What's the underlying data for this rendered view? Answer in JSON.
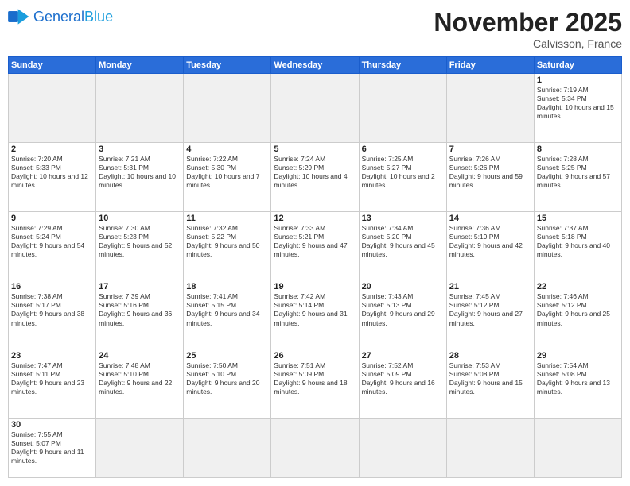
{
  "header": {
    "logo_general": "General",
    "logo_blue": "Blue",
    "month_title": "November 2025",
    "location": "Calvisson, France"
  },
  "days_of_week": [
    "Sunday",
    "Monday",
    "Tuesday",
    "Wednesday",
    "Thursday",
    "Friday",
    "Saturday"
  ],
  "weeks": [
    {
      "days": [
        {
          "num": "",
          "empty": true
        },
        {
          "num": "",
          "empty": true
        },
        {
          "num": "",
          "empty": true
        },
        {
          "num": "",
          "empty": true
        },
        {
          "num": "",
          "empty": true
        },
        {
          "num": "",
          "empty": true
        },
        {
          "num": "1",
          "sunrise": "7:19 AM",
          "sunset": "5:34 PM",
          "daylight": "10 hours and 15 minutes."
        }
      ]
    },
    {
      "days": [
        {
          "num": "2",
          "sunrise": "7:20 AM",
          "sunset": "5:33 PM",
          "daylight": "10 hours and 12 minutes."
        },
        {
          "num": "3",
          "sunrise": "7:21 AM",
          "sunset": "5:31 PM",
          "daylight": "10 hours and 10 minutes."
        },
        {
          "num": "4",
          "sunrise": "7:22 AM",
          "sunset": "5:30 PM",
          "daylight": "10 hours and 7 minutes."
        },
        {
          "num": "5",
          "sunrise": "7:24 AM",
          "sunset": "5:29 PM",
          "daylight": "10 hours and 4 minutes."
        },
        {
          "num": "6",
          "sunrise": "7:25 AM",
          "sunset": "5:27 PM",
          "daylight": "10 hours and 2 minutes."
        },
        {
          "num": "7",
          "sunrise": "7:26 AM",
          "sunset": "5:26 PM",
          "daylight": "9 hours and 59 minutes."
        },
        {
          "num": "8",
          "sunrise": "7:28 AM",
          "sunset": "5:25 PM",
          "daylight": "9 hours and 57 minutes."
        }
      ]
    },
    {
      "days": [
        {
          "num": "9",
          "sunrise": "7:29 AM",
          "sunset": "5:24 PM",
          "daylight": "9 hours and 54 minutes."
        },
        {
          "num": "10",
          "sunrise": "7:30 AM",
          "sunset": "5:23 PM",
          "daylight": "9 hours and 52 minutes."
        },
        {
          "num": "11",
          "sunrise": "7:32 AM",
          "sunset": "5:22 PM",
          "daylight": "9 hours and 50 minutes."
        },
        {
          "num": "12",
          "sunrise": "7:33 AM",
          "sunset": "5:21 PM",
          "daylight": "9 hours and 47 minutes."
        },
        {
          "num": "13",
          "sunrise": "7:34 AM",
          "sunset": "5:20 PM",
          "daylight": "9 hours and 45 minutes."
        },
        {
          "num": "14",
          "sunrise": "7:36 AM",
          "sunset": "5:19 PM",
          "daylight": "9 hours and 42 minutes."
        },
        {
          "num": "15",
          "sunrise": "7:37 AM",
          "sunset": "5:18 PM",
          "daylight": "9 hours and 40 minutes."
        }
      ]
    },
    {
      "days": [
        {
          "num": "16",
          "sunrise": "7:38 AM",
          "sunset": "5:17 PM",
          "daylight": "9 hours and 38 minutes."
        },
        {
          "num": "17",
          "sunrise": "7:39 AM",
          "sunset": "5:16 PM",
          "daylight": "9 hours and 36 minutes."
        },
        {
          "num": "18",
          "sunrise": "7:41 AM",
          "sunset": "5:15 PM",
          "daylight": "9 hours and 34 minutes."
        },
        {
          "num": "19",
          "sunrise": "7:42 AM",
          "sunset": "5:14 PM",
          "daylight": "9 hours and 31 minutes."
        },
        {
          "num": "20",
          "sunrise": "7:43 AM",
          "sunset": "5:13 PM",
          "daylight": "9 hours and 29 minutes."
        },
        {
          "num": "21",
          "sunrise": "7:45 AM",
          "sunset": "5:12 PM",
          "daylight": "9 hours and 27 minutes."
        },
        {
          "num": "22",
          "sunrise": "7:46 AM",
          "sunset": "5:12 PM",
          "daylight": "9 hours and 25 minutes."
        }
      ]
    },
    {
      "days": [
        {
          "num": "23",
          "sunrise": "7:47 AM",
          "sunset": "5:11 PM",
          "daylight": "9 hours and 23 minutes."
        },
        {
          "num": "24",
          "sunrise": "7:48 AM",
          "sunset": "5:10 PM",
          "daylight": "9 hours and 22 minutes."
        },
        {
          "num": "25",
          "sunrise": "7:50 AM",
          "sunset": "5:10 PM",
          "daylight": "9 hours and 20 minutes."
        },
        {
          "num": "26",
          "sunrise": "7:51 AM",
          "sunset": "5:09 PM",
          "daylight": "9 hours and 18 minutes."
        },
        {
          "num": "27",
          "sunrise": "7:52 AM",
          "sunset": "5:09 PM",
          "daylight": "9 hours and 16 minutes."
        },
        {
          "num": "28",
          "sunrise": "7:53 AM",
          "sunset": "5:08 PM",
          "daylight": "9 hours and 15 minutes."
        },
        {
          "num": "29",
          "sunrise": "7:54 AM",
          "sunset": "5:08 PM",
          "daylight": "9 hours and 13 minutes."
        }
      ]
    },
    {
      "days": [
        {
          "num": "30",
          "sunrise": "7:55 AM",
          "sunset": "5:07 PM",
          "daylight": "9 hours and 11 minutes."
        },
        {
          "num": "",
          "empty": true
        },
        {
          "num": "",
          "empty": true
        },
        {
          "num": "",
          "empty": true
        },
        {
          "num": "",
          "empty": true
        },
        {
          "num": "",
          "empty": true
        },
        {
          "num": "",
          "empty": true
        }
      ]
    }
  ]
}
